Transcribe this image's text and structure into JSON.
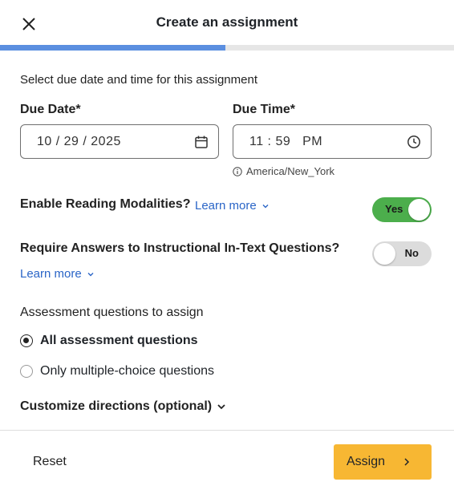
{
  "header": {
    "title": "Create an assignment",
    "progress_percent": 49.6
  },
  "schedule": {
    "instructions": "Select due date and time for this assignment",
    "due_date_label": "Due Date",
    "due_time_label": "Due Time",
    "required_marker": "*",
    "due_date_value": "10 / 29 / 2025",
    "due_time_value": "11 : 59   PM",
    "timezone": "America/New_York"
  },
  "reading_modalities": {
    "label": "Enable Reading Modalities?",
    "learn_more": "Learn more",
    "toggle_label": "Yes",
    "enabled": true
  },
  "instructional_questions": {
    "label": "Require Answers to Instructional In-Text Questions?",
    "learn_more": "Learn more",
    "toggle_label": "No",
    "enabled": false
  },
  "assessment": {
    "label": "Assessment questions to assign",
    "options": [
      {
        "label": "All assessment questions",
        "selected": true
      },
      {
        "label": "Only multiple-choice questions",
        "selected": false
      }
    ]
  },
  "customize": {
    "label": "Customize directions (optional)"
  },
  "footer": {
    "reset_label": "Reset",
    "assign_label": "Assign"
  },
  "colors": {
    "progress": "#5b8fe0",
    "toggle_on": "#4cae4c",
    "link": "#2a65c7",
    "assign_button": "#f7b733"
  },
  "icons": {
    "close": "close-icon",
    "calendar": "calendar-icon",
    "clock": "clock-icon",
    "info": "info-icon",
    "chevron_down": "chevron-down-icon",
    "chevron_right": "chevron-right-icon"
  }
}
